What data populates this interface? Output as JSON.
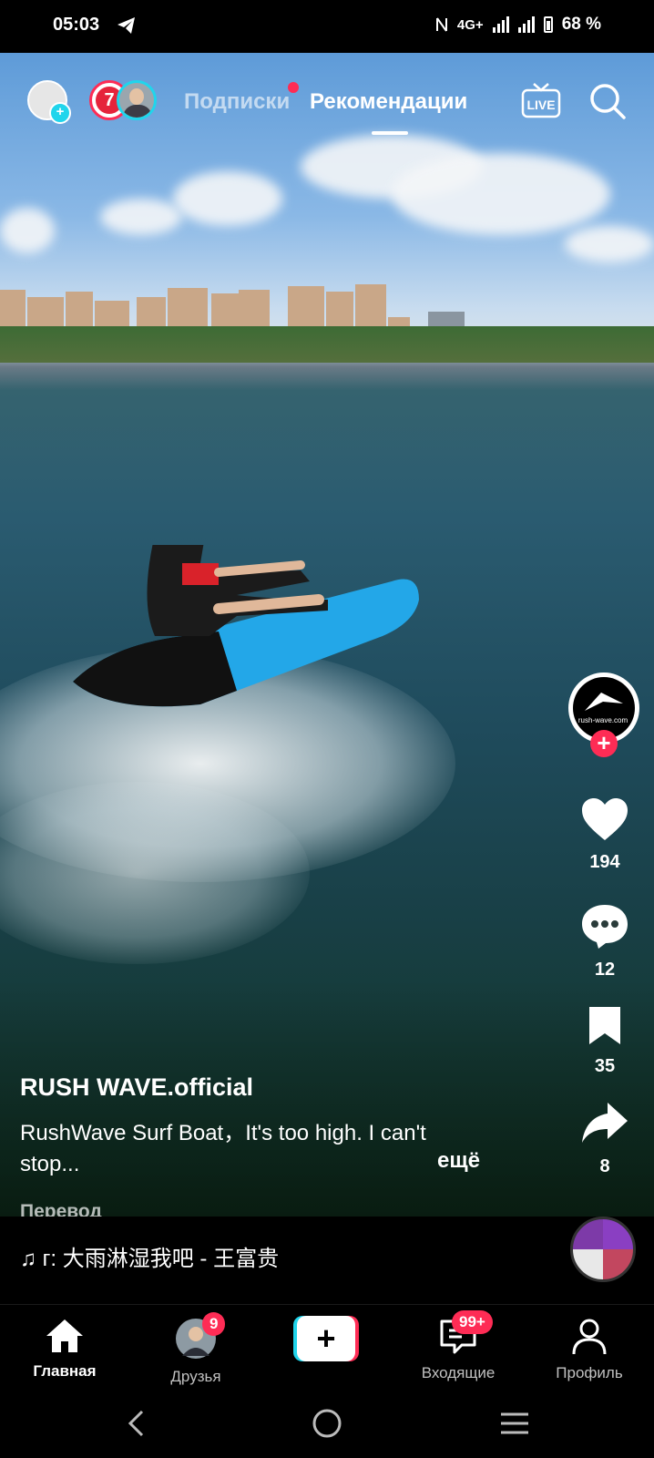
{
  "status_bar": {
    "time": "05:03",
    "network": "4G+",
    "battery": "68 %"
  },
  "top_nav": {
    "story_badge": "7",
    "tab_following": "Подписки",
    "tab_recommended": "Рекомендации",
    "live_label": "LIVE"
  },
  "side_actions": {
    "profile_logo_text": "rush-wave.com",
    "likes": "194",
    "comments": "12",
    "saves": "35",
    "shares": "8"
  },
  "caption": {
    "username": "RUSH WAVE.official",
    "text": "RushWave Surf Boat，It's too high. I can't stop...",
    "more": "ещё",
    "translate": "Перевод"
  },
  "music": {
    "text": "♫ г: 大雨淋湿我吧 - 王富贵"
  },
  "bottom_nav": {
    "home": "Главная",
    "friends": "Друзья",
    "friends_badge": "9",
    "inbox": "Входящие",
    "inbox_badge": "99+",
    "profile": "Профиль",
    "create": "+"
  },
  "colors": {
    "accent_red": "#fe2c55",
    "accent_cyan": "#20d5ec"
  }
}
